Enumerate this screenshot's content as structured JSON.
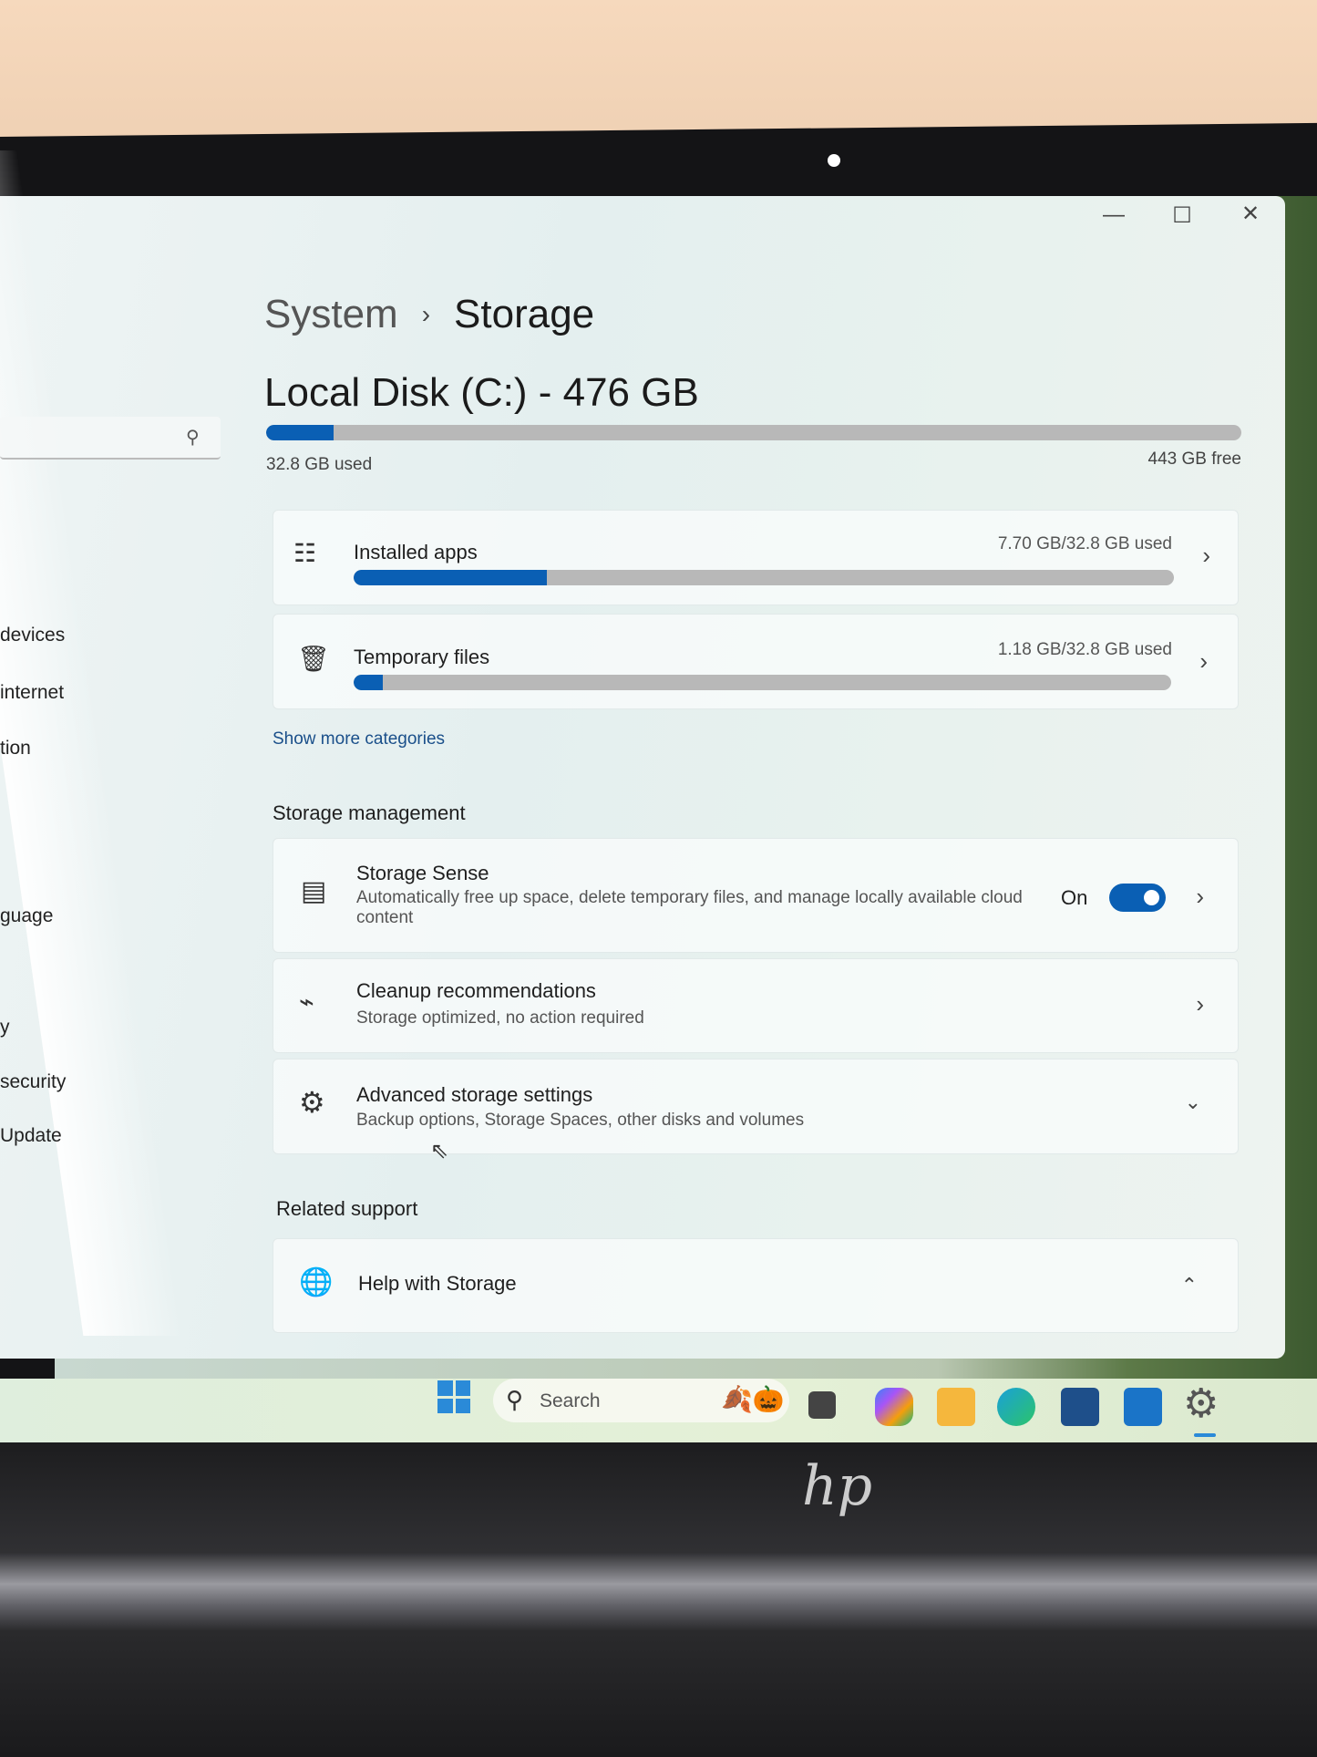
{
  "window": {
    "minimize_icon": "minimize-icon",
    "maximize_icon": "maximize-icon",
    "close_icon": "close-icon"
  },
  "breadcrumb": {
    "parent": "System",
    "separator": "›",
    "current": "Storage"
  },
  "disk": {
    "title": "Local Disk (C:) - 476 GB",
    "used_label": "32.8 GB used",
    "free_label": "443 GB free",
    "used_fraction": 0.069
  },
  "categories": [
    {
      "label": "Installed apps",
      "value": "7.70 GB/32.8 GB used",
      "fraction": 0.235,
      "icon": "apps-list-icon"
    },
    {
      "label": "Temporary files",
      "value": "1.18 GB/32.8 GB used",
      "fraction": 0.036,
      "icon": "trash-icon"
    }
  ],
  "show_more": "Show more categories",
  "storage_management": {
    "heading": "Storage management",
    "storage_sense": {
      "title": "Storage Sense",
      "desc": "Automatically free up space, delete temporary files, and manage locally available cloud",
      "desc2": "content",
      "state": "On",
      "toggle_on": true
    },
    "cleanup": {
      "title": "Cleanup recommendations",
      "desc": "Storage optimized, no action required"
    },
    "advanced": {
      "title": "Advanced storage settings",
      "desc": "Backup options, Storage Spaces, other disks and volumes"
    }
  },
  "related": {
    "heading": "Related support",
    "help": "Help with Storage"
  },
  "sidebar": {
    "items": [
      "devices",
      "internet",
      "tion",
      "guage",
      "y",
      "security",
      "Update"
    ]
  },
  "taskbar": {
    "search_placeholder": "Search",
    "apps": [
      "task-view",
      "copilot",
      "file-explorer",
      "edge",
      "store",
      "outlook",
      "settings"
    ]
  },
  "colors": {
    "accent": "#0a5fb4",
    "bar_track": "#b8b8b8"
  }
}
